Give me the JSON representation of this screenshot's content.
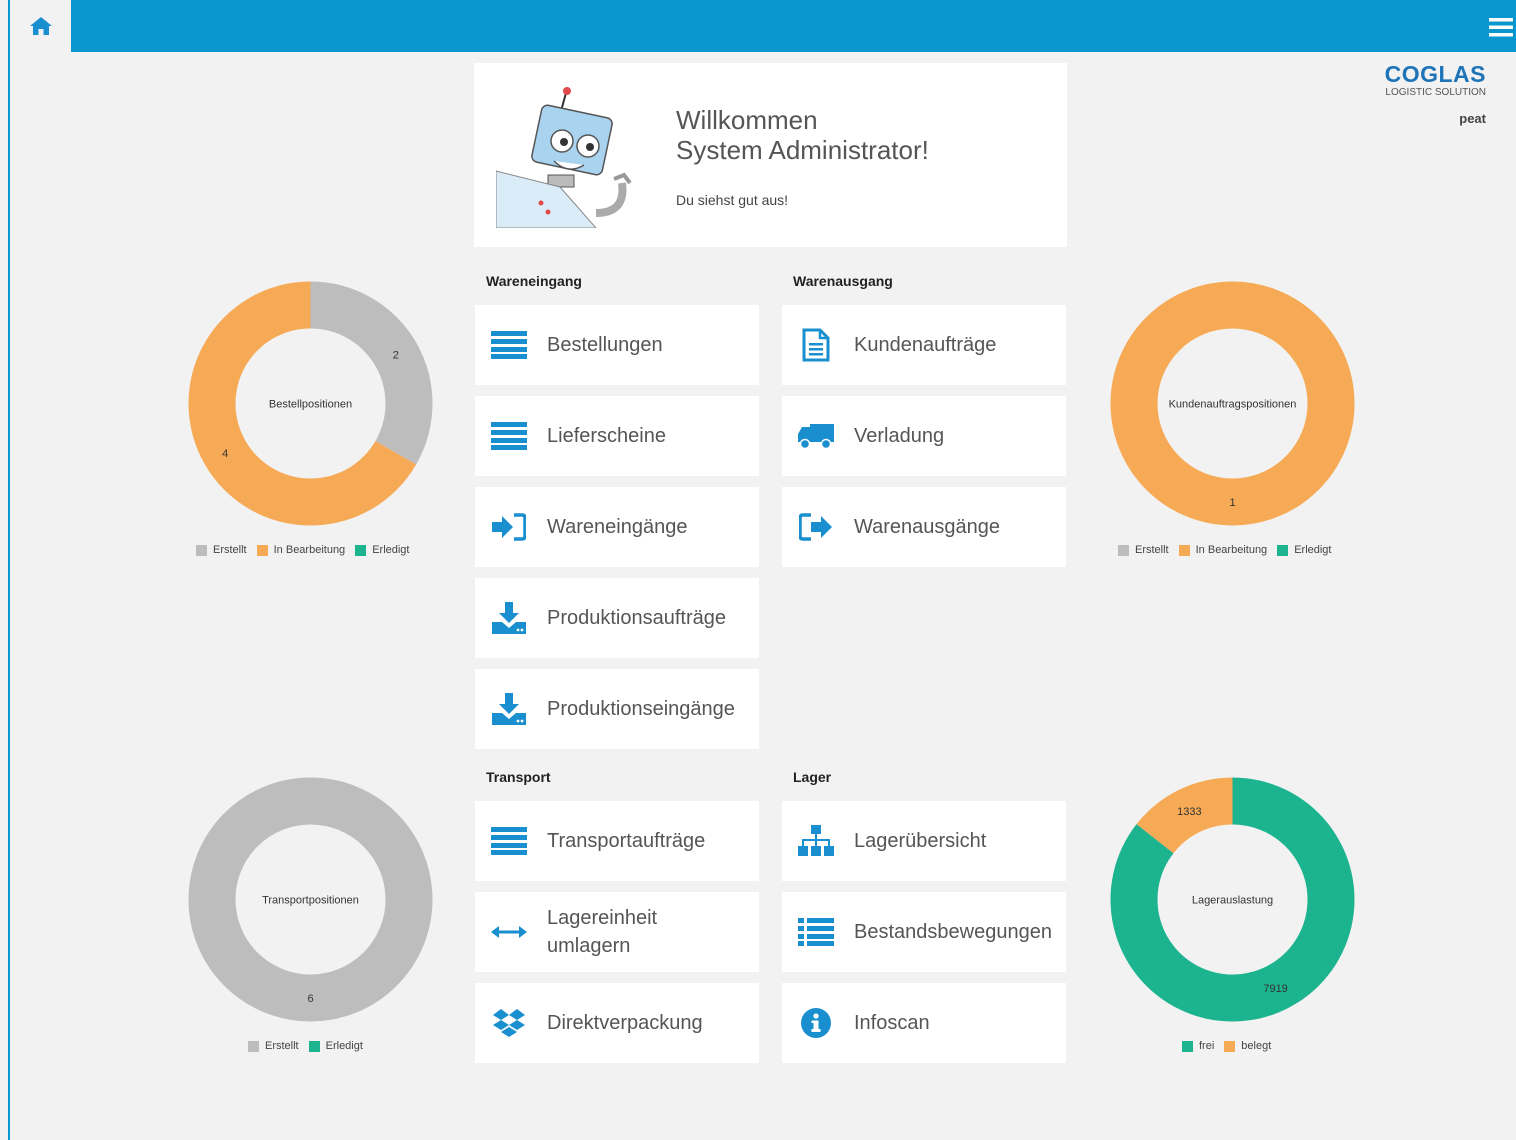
{
  "header": {
    "home_icon": "home-icon",
    "menu_icon": "hamburger-menu-icon"
  },
  "logo": {
    "brand": "COGLAS",
    "tagline": "LOGISTIC SOLUTION"
  },
  "user": {
    "name": "peat"
  },
  "welcome": {
    "line1": "Willkommen",
    "line2": "System Administrator!",
    "sub": "Du siehst gut aus!"
  },
  "sections": {
    "wareneingang": "Wareneingang",
    "warenausgang": "Warenausgang",
    "transport": "Transport",
    "lager": "Lager"
  },
  "tiles": {
    "bestellungen": "Bestellungen",
    "lieferscheine": "Lieferscheine",
    "wareneingaenge": "Wareneingänge",
    "produktionsauftraege": "Produktionsaufträge",
    "produktionseingaenge": "Produktionseingänge",
    "kundenauftraege": "Kundenaufträge",
    "verladung": "Verladung",
    "warenausgaenge": "Warenausgänge",
    "transportauftraege": "Transportaufträge",
    "lagereinheit_1": "Lagereinheit",
    "lagereinheit_2": "umlagern",
    "direktverpackung": "Direktverpackung",
    "lageruebersicht": "Lagerübersicht",
    "bestandsbewegungen": "Bestandsbewegungen",
    "infoscan": "Infoscan"
  },
  "colors": {
    "accent": "#0a97cf",
    "icon": "#1a8fd0",
    "grey": "#bdbdbd",
    "orange": "#f6aa56",
    "green": "#1cb38f"
  },
  "chart_data": [
    {
      "type": "pie",
      "title": "Bestellpositionen",
      "labels": [
        "Erstellt",
        "In Bearbeitung",
        "Erledigt"
      ],
      "values": [
        2,
        4,
        0
      ],
      "colors": [
        "#bdbdbd",
        "#f6aa56",
        "#1cb38f"
      ],
      "legend": "bottom"
    },
    {
      "type": "pie",
      "title": "Kundenauftragspositionen",
      "labels": [
        "Erstellt",
        "In Bearbeitung",
        "Erledigt"
      ],
      "values": [
        0,
        1,
        0
      ],
      "colors": [
        "#bdbdbd",
        "#f6aa56",
        "#1cb38f"
      ],
      "legend": "bottom"
    },
    {
      "type": "pie",
      "title": "Transportpositionen",
      "labels": [
        "Erstellt",
        "Erledigt"
      ],
      "values": [
        6,
        0
      ],
      "colors": [
        "#bdbdbd",
        "#1cb38f"
      ],
      "legend": "bottom"
    },
    {
      "type": "pie",
      "title": "Lagerauslastung",
      "labels": [
        "frei",
        "belegt"
      ],
      "values": [
        7919,
        1333
      ],
      "colors": [
        "#1cb38f",
        "#f6aa56"
      ],
      "legend": "bottom"
    }
  ]
}
